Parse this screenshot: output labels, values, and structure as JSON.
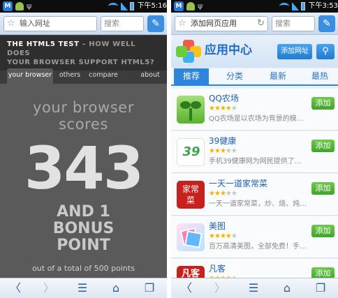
{
  "status_left": {
    "time": "下午5:16"
  },
  "status_right": {
    "time": "下午3:53"
  },
  "left": {
    "url_placeholder": "输入网址",
    "search_placeholder": "搜索",
    "header_line1": "THE HTML5 TEST",
    "header_line1_rest": " – HOW WELL DOES",
    "header_line2": "YOUR BROWSER SUPPORT HTML5?",
    "tabs": [
      "your browser",
      "others",
      "compare",
      "about"
    ],
    "lead_line1": "your browser",
    "lead_line2": "scores",
    "score": "343",
    "bonus_line1": "AND 1",
    "bonus_line2": "BONUS",
    "bonus_line3": "POINT",
    "total": "out of a total of 500 points"
  },
  "right": {
    "url_value": "添加网页应用",
    "search_placeholder": "搜索",
    "title": "应用中心",
    "add_url_label": "添加网址",
    "tabs": [
      "推荐",
      "分类",
      "最新",
      "最热"
    ],
    "apps": [
      {
        "name": "QQ农场",
        "rating": 4,
        "desc": "QQ农场是以农场为背景的模拟经营...",
        "action": "添加"
      },
      {
        "name": "39健康",
        "rating": 3,
        "desc": "手机39健康网为网民提供了最新的...",
        "action": "添加"
      },
      {
        "name": "一天一道家常菜",
        "rating": 3,
        "desc": "一天一道家常菜，炒、烧、炖、煮...",
        "action": "添加"
      },
      {
        "name": "美图",
        "rating": 4,
        "desc": "百万高清美图，全部免费！手机享...",
        "action": "添加"
      },
      {
        "name": "凡客",
        "rating": 4,
        "desc": "",
        "action": "添加"
      }
    ],
    "icon_labels": {
      "cook_top": "家常",
      "cook_bottom": "菜",
      "fanke": "凡客",
      "n39": "39"
    }
  },
  "icons": {
    "back": "back-arrow-icon",
    "forward": "forward-arrow-icon",
    "menu": "menu-icon",
    "home": "home-icon",
    "windows": "windows-icon",
    "tools": "tools-icon",
    "star": "star-icon",
    "reload": "reload-icon",
    "search": "search-icon"
  },
  "colors": {
    "accent": "#2d86dc",
    "add_button": "#3fa52a",
    "app_name": "#1d5fb0",
    "html5_bg": "#5a5a5a"
  }
}
